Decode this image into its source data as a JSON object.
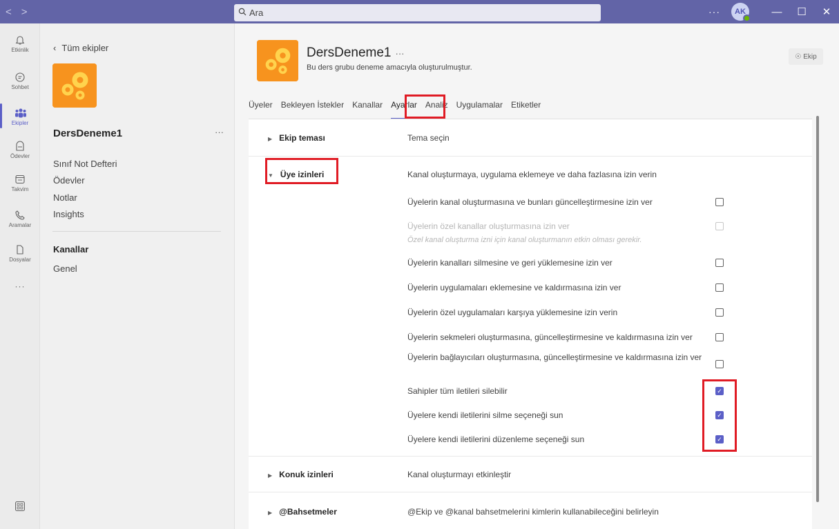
{
  "search": {
    "placeholder": "Ara"
  },
  "titlebar": {
    "avatar_initials": "AK",
    "more": "···",
    "nav_back": "<",
    "nav_forward": ">"
  },
  "rail": {
    "items": [
      {
        "label": "Etkinlik",
        "icon": "bell-icon"
      },
      {
        "label": "Sohbet",
        "icon": "chat-icon"
      },
      {
        "label": "Ekipler",
        "icon": "teams-icon"
      },
      {
        "label": "Ödevler",
        "icon": "assignments-icon"
      },
      {
        "label": "Takvim",
        "icon": "calendar-icon"
      },
      {
        "label": "Aramalar",
        "icon": "phone-icon"
      },
      {
        "label": "Dosyalar",
        "icon": "files-icon"
      }
    ],
    "more": "···"
  },
  "left": {
    "back_label": "Tüm ekipler",
    "team_name": "DersDeneme1",
    "team_more": "···",
    "links": [
      "Sınıf Not Defteri",
      "Ödevler",
      "Notlar",
      "Insights"
    ],
    "channels_heading": "Kanallar",
    "channels": [
      "Genel"
    ]
  },
  "main": {
    "title": "DersDeneme1",
    "title_more": "···",
    "description": "Bu ders grubu deneme amacıyla oluşturulmuştur.",
    "ekip_button": "Ekip",
    "tabs": [
      "Üyeler",
      "Bekleyen İstekler",
      "Kanallar",
      "Ayarlar",
      "Analiz",
      "Uygulamalar",
      "Etiketler"
    ],
    "active_tab": "Ayarlar"
  },
  "settings": {
    "sections": [
      {
        "title": "Ekip teması",
        "desc": "Tema seçin"
      },
      {
        "title": "Üye izinleri",
        "desc": "Kanal oluşturmaya, uygulama eklemeye ve daha fazlasına izin verin"
      },
      {
        "title": "Konuk izinleri",
        "desc": "Kanal oluşturmayı etkinleştir"
      },
      {
        "title": "@Bahsetmeler",
        "desc": "@Ekip ve @kanal bahsetmelerini kimlerin kullanabileceğini belirleyin"
      }
    ],
    "options": [
      {
        "label": "Üyelerin kanal oluşturmasına ve bunları güncelleştirmesine izin ver",
        "checked": false
      },
      {
        "label": "Üyelerin özel kanallar oluşturmasına izin ver",
        "checked": false,
        "disabled": true
      },
      {
        "label": "Üyelerin kanalları silmesine ve geri yüklemesine izin ver",
        "checked": false
      },
      {
        "label": "Üyelerin uygulamaları eklemesine ve kaldırmasına izin ver",
        "checked": false
      },
      {
        "label": "Üyelerin özel uygulamaları karşıya yüklemesine izin verin",
        "checked": false
      },
      {
        "label": "Üyelerin sekmeleri oluşturmasına, güncelleştirmesine ve kaldırmasına izin ver",
        "checked": false
      },
      {
        "label": "Üyelerin bağlayıcıları oluşturmasına, güncelleştirmesine ve kaldırmasına izin ver",
        "checked": false
      },
      {
        "label": "Sahipler tüm iletileri silebilir",
        "checked": true
      },
      {
        "label": "Üyelere kendi iletilerini silme seçeneği sun",
        "checked": true
      },
      {
        "label": "Üyelere kendi iletilerini düzenleme seçeneği sun",
        "checked": true
      }
    ],
    "private_channel_note": "Özel kanal oluşturma izni için kanal oluşturmanın etkin olması gerekir."
  },
  "colors": {
    "accent": "#5b5fc7",
    "titlebar": "#6264a7",
    "highlight": "#e01b24",
    "team_image": "#f7931e"
  }
}
